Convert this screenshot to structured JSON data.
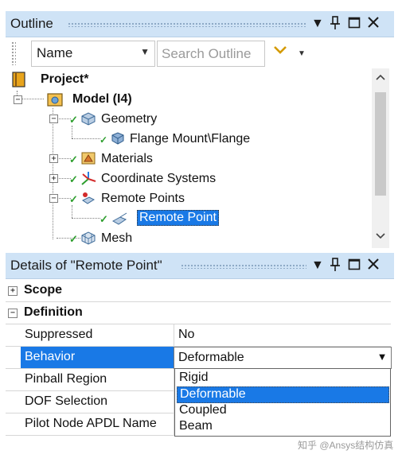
{
  "outline": {
    "title": "Outline",
    "name_filter": "Name",
    "search_placeholder": "Search Outline",
    "tree": [
      {
        "label": "Project*"
      },
      {
        "label": "Model (I4)"
      },
      {
        "label": "Geometry"
      },
      {
        "label": "Flange Mount\\Flange"
      },
      {
        "label": "Materials"
      },
      {
        "label": "Coordinate Systems"
      },
      {
        "label": "Remote Points"
      },
      {
        "label": "Remote Point"
      },
      {
        "label": "Mesh"
      }
    ]
  },
  "details": {
    "title": "Details of \"Remote Point\"",
    "sections": [
      {
        "label": "Scope",
        "expander": "+"
      },
      {
        "label": "Definition",
        "expander": "−"
      }
    ],
    "rows": [
      {
        "key": "Suppressed",
        "value": "No"
      },
      {
        "key": "Behavior",
        "value": "Deformable"
      },
      {
        "key": "Pinball Region",
        "value": ""
      },
      {
        "key": "DOF Selection",
        "value": ""
      },
      {
        "key": "Pilot Node APDL Name",
        "value": ""
      }
    ],
    "behavior_options": [
      "Rigid",
      "Deformable",
      "Coupled",
      "Beam"
    ],
    "behavior_selected": "Deformable"
  },
  "window_controls": {
    "dropdown": "▾",
    "pin": "📌",
    "maximize": "☐",
    "close": "✕"
  },
  "watermark": "知乎 @Ansys结构仿真",
  "colors": {
    "titlebar": "#cfe3f6",
    "selection": "#1979e6",
    "check": "#2e9e2e"
  }
}
